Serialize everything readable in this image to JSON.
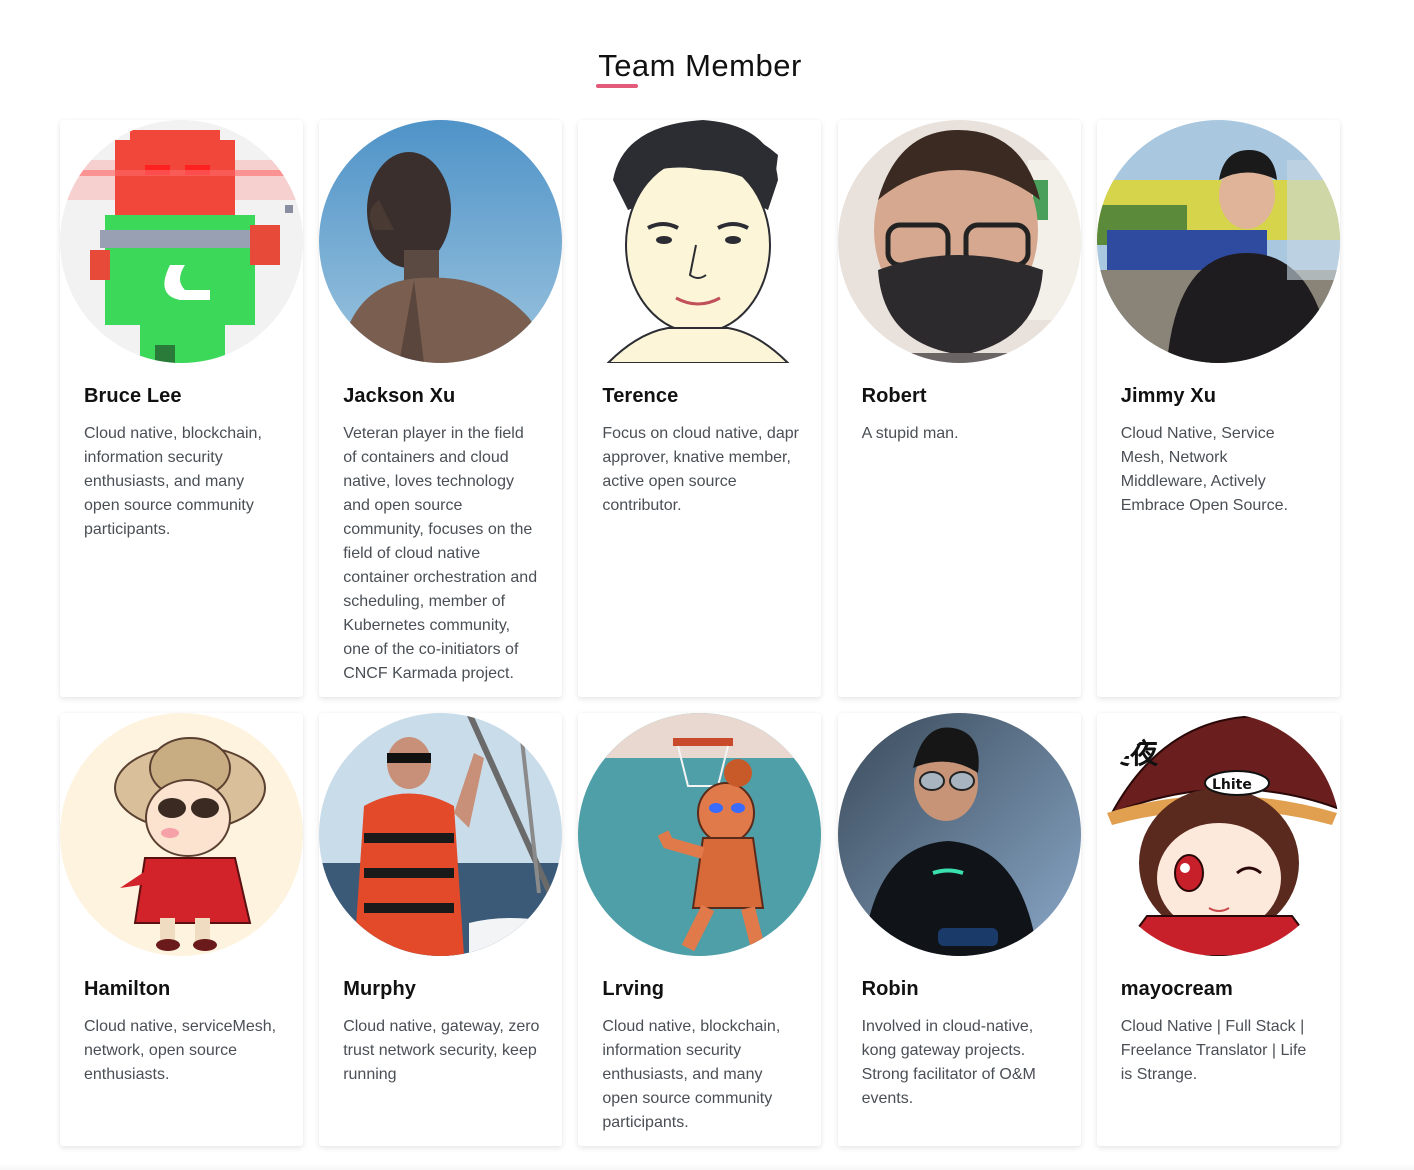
{
  "section": {
    "title": "Team Member"
  },
  "accent_color": "#e35a7a",
  "members": [
    {
      "name": "Bruce Lee",
      "bio": "Cloud native, blockchain, information security enthusiasts, and many open source community participants.",
      "avatar_icon": "pixel-robot-avatar"
    },
    {
      "name": "Jackson Xu",
      "bio": "Veteran player in the field of containers and cloud native, loves technology and open source community, focuses on the field of cloud native container orchestration and scheduling, member of Kubernetes community, one of the co-initiators of CNCF Karmada project.",
      "avatar_icon": "silhouette-sky-avatar"
    },
    {
      "name": "Terence",
      "bio": "Focus on cloud native, dapr approver, knative member, active open source contributor.",
      "avatar_icon": "cartoon-portrait-avatar"
    },
    {
      "name": "Robert",
      "bio": "A stupid man.",
      "avatar_icon": "masked-face-avatar"
    },
    {
      "name": "Jimmy Xu",
      "bio": "Cloud Native, Service Mesh, Network Middleware, Actively Embrace Open Source.",
      "avatar_icon": "outdoor-portrait-avatar"
    },
    {
      "name": "Hamilton",
      "bio": "Cloud native, serviceMesh, network, open source enthusiasts.",
      "avatar_icon": "cartoon-hat-avatar"
    },
    {
      "name": "Murphy",
      "bio": "Cloud native, gateway, zero trust network security, keep running",
      "avatar_icon": "boat-life-jacket-avatar"
    },
    {
      "name": "Lrving",
      "bio": "Cloud native, blockchain, information security enthusiasts, and many open source community participants.",
      "avatar_icon": "basketball-cartoon-avatar"
    },
    {
      "name": "Robin",
      "bio": "Involved in cloud-native, kong gateway projects. Strong facilitator of O&M events.",
      "avatar_icon": "sunglasses-portrait-avatar"
    },
    {
      "name": "mayocream",
      "bio": "Cloud Native | Full Stack | Freelance Translator | Life is Strange.",
      "avatar_icon": "anime-girl-avatar"
    }
  ]
}
